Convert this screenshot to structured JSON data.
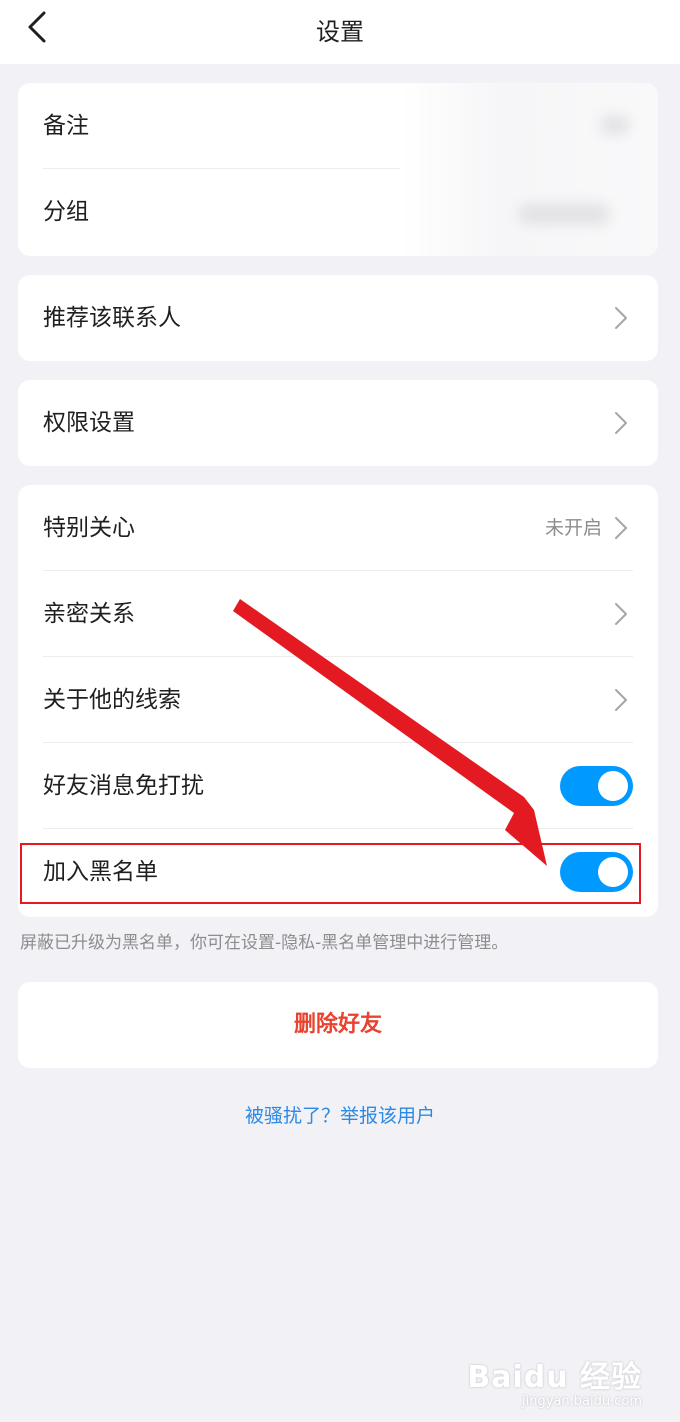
{
  "header": {
    "title": "设置"
  },
  "card1": {
    "items": [
      {
        "label": "备注"
      },
      {
        "label": "分组"
      }
    ]
  },
  "card2": {
    "items": [
      {
        "label": "推荐该联系人"
      }
    ]
  },
  "card3": {
    "items": [
      {
        "label": "权限设置"
      }
    ]
  },
  "card4": {
    "items": [
      {
        "label": "特别关心",
        "value": "未开启"
      },
      {
        "label": "亲密关系"
      },
      {
        "label": "关于他的线索"
      },
      {
        "label": "好友消息免打扰",
        "toggle": true
      },
      {
        "label": "加入黑名单",
        "toggle": true
      }
    ]
  },
  "hint": "屏蔽已升级为黑名单，你可在设置-隐私-黑名单管理中进行管理。",
  "delete_button": "删除好友",
  "report_link": "被骚扰了？举报该用户",
  "watermark": {
    "logo": "Baidu 经验",
    "url": "jingyan.baidu.com"
  },
  "colors": {
    "accent": "#0099ff",
    "danger": "#e8432f",
    "link": "#2b8ae5",
    "annotation": "#e31a22",
    "background": "#f1f1f6"
  }
}
